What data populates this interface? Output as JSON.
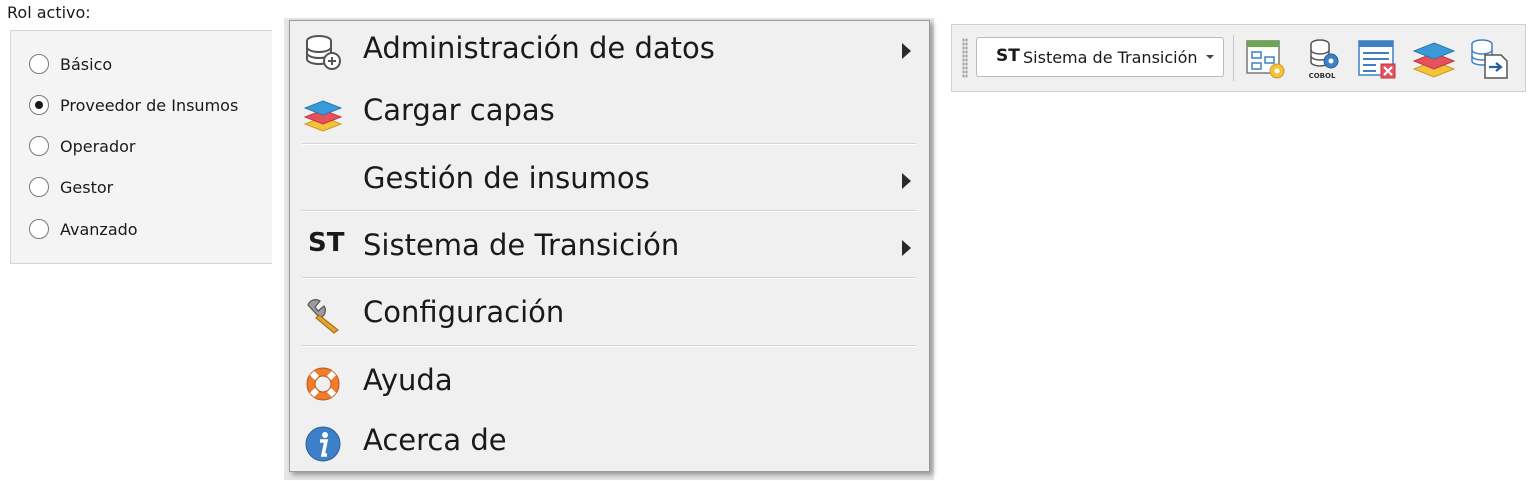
{
  "role_panel": {
    "title": "Rol activo:",
    "options": [
      {
        "label": "Básico",
        "checked": false
      },
      {
        "label": "Proveedor de Insumos",
        "checked": true
      },
      {
        "label": "Operador",
        "checked": false
      },
      {
        "label": "Gestor",
        "checked": false
      },
      {
        "label": "Avanzado",
        "checked": false
      }
    ]
  },
  "menu": {
    "items": [
      {
        "label": "Administración de datos",
        "icon": "database-add-icon",
        "submenu": true
      },
      {
        "label": "Cargar capas",
        "icon": "layers-icon",
        "submenu": false
      },
      {
        "label": "Gestión de insumos",
        "icon": "",
        "submenu": true
      },
      {
        "label": "Sistema de Transición",
        "icon": "st-icon",
        "icon_text": "ST",
        "submenu": true
      },
      {
        "label": "Configuración",
        "icon": "wrench-icon",
        "submenu": false
      },
      {
        "label": "Ayuda",
        "icon": "lifebuoy-icon",
        "submenu": false
      },
      {
        "label": "Acerca de",
        "icon": "info-icon",
        "submenu": false
      }
    ]
  },
  "toolbar": {
    "combo_icon_text": "ST",
    "combo_label": "Sistema de Transición",
    "buttons": [
      {
        "icon": "model-settings-icon"
      },
      {
        "icon": "cobol-database-icon",
        "icon_text": "COBOL"
      },
      {
        "icon": "table-delete-icon"
      },
      {
        "icon": "layers-icon"
      },
      {
        "icon": "database-export-icon"
      }
    ]
  },
  "colors": {
    "panel_bg": "#f4f4f4",
    "menu_bg": "#f0f0f0",
    "toolbar_bg": "#f0f0f0",
    "layer_red": "#e8505b",
    "layer_yellow": "#f5c23a",
    "layer_blue": "#3a9ad9",
    "lifebuoy_orange": "#f07b2b",
    "info_blue": "#3d80c8"
  }
}
